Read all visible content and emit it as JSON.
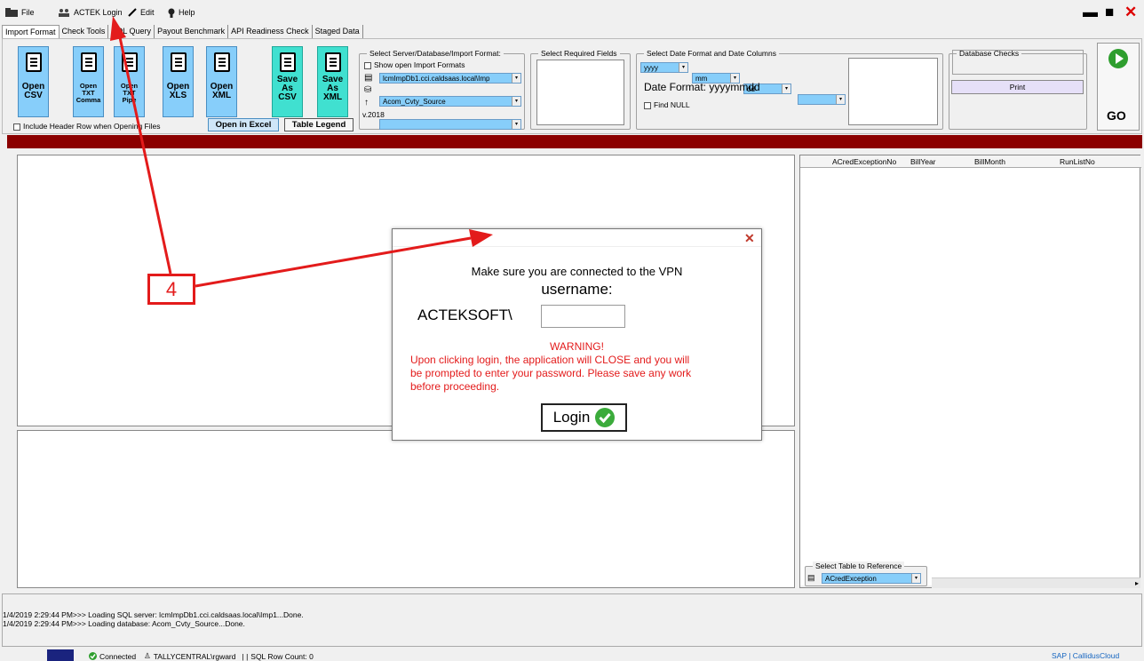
{
  "menu": {
    "file": "File",
    "actek_login": "ACTEK Login",
    "edit": "Edit",
    "help": "Help"
  },
  "tabs": [
    "Import Format",
    "Check Tools",
    "SQL Query",
    "Payout Benchmark",
    "API Readiness Check",
    "Staged Data"
  ],
  "toolbar": {
    "open_csv": [
      "Open",
      "CSV"
    ],
    "open_txt_comma": [
      "Open",
      "TXT",
      "Comma"
    ],
    "open_txt_pipe": [
      "Open",
      "TXT",
      "Pipe"
    ],
    "open_xls": [
      "Open",
      "XLS"
    ],
    "open_xml": [
      "Open",
      "XML"
    ],
    "save_as_csv": [
      "Save",
      "As",
      "CSV"
    ],
    "save_as_xml": [
      "Save",
      "As",
      "XML"
    ],
    "include_header": "Include Header Row when Opening Files",
    "open_in_excel": "Open in Excel",
    "table_legend": "Table Legend"
  },
  "server_group": {
    "title": "Select Server/Database/Import Format:",
    "show_open": "Show open Import Formats",
    "server": "lcmImpDb1.cci.caldsaas.local\\Imp",
    "database": "Acom_Cvty_Source",
    "format": "",
    "version": "v.2018"
  },
  "required_fields": {
    "title": "Select Required Fields"
  },
  "date_group": {
    "title": "Select Date Format and Date Columns",
    "year": "yyyy",
    "month": "mm",
    "day": "dd",
    "extra": "",
    "format_label": "Date Format: yyyymmdd",
    "find_null": "Find NULL"
  },
  "db_checks": {
    "title": "Database Checks",
    "print": "Print"
  },
  "go": {
    "label": "GO"
  },
  "grid": {
    "columns": [
      "ACredExceptionNo",
      "BillYear",
      "BillMonth",
      "RunListNo"
    ]
  },
  "reference": {
    "title": "Select Table to Reference",
    "value": "ACredException"
  },
  "dialog": {
    "close": "✕",
    "vpn": "Make sure you are connected to the VPN",
    "username_label": "username:",
    "domain": "ACTEKSOFT\\",
    "username_value": "",
    "warning_title": "WARNING!",
    "warning_lines": [
      "Upon clicking login, the application will CLOSE and you will",
      "be prompted to enter your password. Please save any work",
      "before proceeding."
    ],
    "login": "Login"
  },
  "annotation": {
    "number": "4"
  },
  "log": [
    "1/4/2019 2:29:44 PM>>>  Loading SQL server: lcmImpDb1.cci.caldsaas.local\\Imp1...Done.",
    "1/4/2019 2:29:44 PM>>>  Loading database: Acom_Cvty_Source...Done."
  ],
  "status": {
    "connected": "Connected",
    "user": "TALLYCENTRAL\\rgward",
    "sep": "|  |",
    "rowcount": "SQL Row Count:  0",
    "right": "SAP  |  CallidusCloud"
  },
  "colors": {
    "red": "#e31b1b",
    "darkred": "#8b0000",
    "lightblue": "#87cefa",
    "teal": "#40e0d0",
    "green": "#2e9e2e"
  }
}
